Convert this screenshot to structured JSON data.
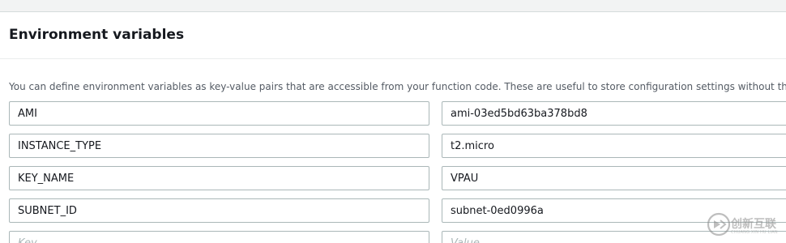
{
  "panel": {
    "title": "Environment variables",
    "description": "You can define environment variables as key-value pairs that are accessible from your function code. These are useful to store configuration settings without the need to change"
  },
  "env_vars": [
    {
      "key": "AMI",
      "value": "ami-03ed5bd63ba378bd8"
    },
    {
      "key": "INSTANCE_TYPE",
      "value": "t2.micro"
    },
    {
      "key": "KEY_NAME",
      "value": "VPAU"
    },
    {
      "key": "SUBNET_ID",
      "value": "subnet-0ed0996a"
    }
  ],
  "new_row": {
    "key_placeholder": "Key",
    "value_placeholder": "Value"
  },
  "watermark": {
    "text": "创新互联",
    "subtext": "CHUANG XIN HU LIAN"
  },
  "colors": {
    "background": "#f2f3f3",
    "panel": "#ffffff",
    "input_border": "#aab7b8",
    "text": "#16191f",
    "description_text": "#545b64"
  }
}
